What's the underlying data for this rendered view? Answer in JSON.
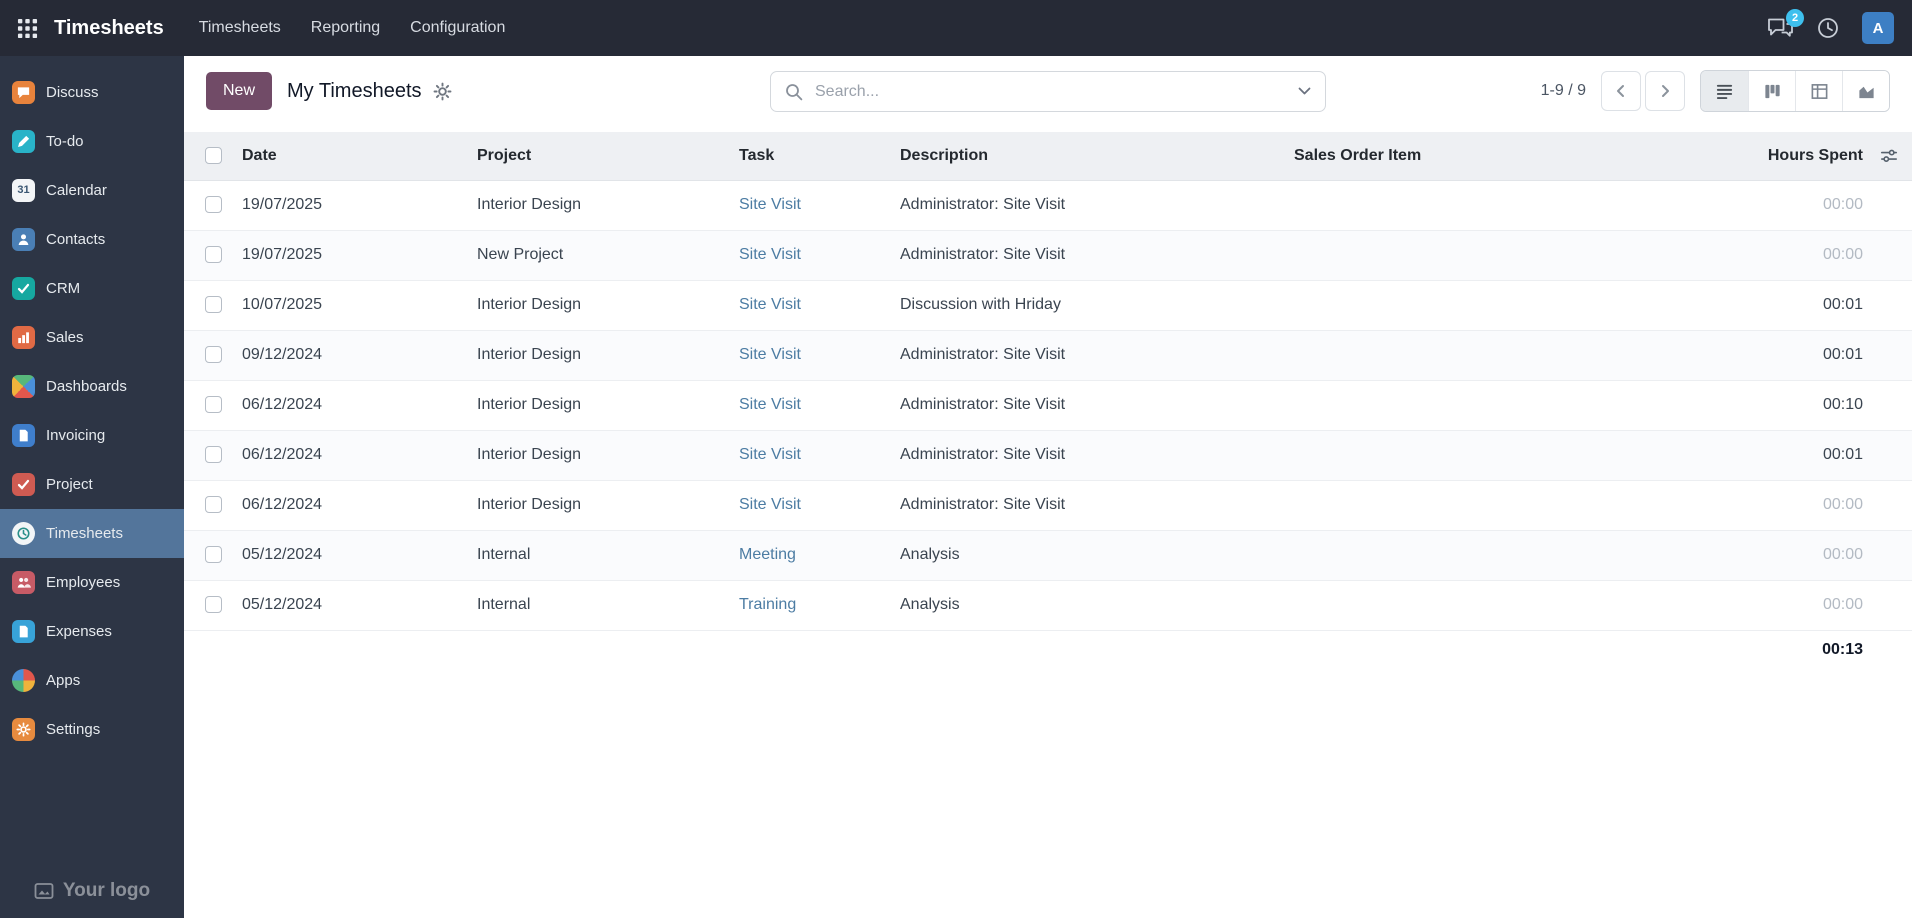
{
  "colors": {
    "topbar_bg": "#262a36",
    "sidebar_bg": "#2d3545",
    "sidebar_active_bg": "#53759b",
    "primary": "#714B67",
    "link": "#4c7ca3",
    "badge": "#3ec0ee",
    "avatar_bg": "#3d7fc4"
  },
  "topbar": {
    "brand": "Timesheets",
    "menu_items": [
      "Timesheets",
      "Reporting",
      "Configuration"
    ],
    "messages_badge": "2",
    "avatar_initial": "A"
  },
  "sidebar": {
    "active": "Timesheets",
    "logo_text": "Your logo",
    "items": [
      {
        "label": "Discuss",
        "icon": "discuss-icon",
        "color": "#e8833c",
        "glyph": "bubble"
      },
      {
        "label": "To-do",
        "icon": "todo-icon",
        "color": "#29b3c8",
        "glyph": "pencil"
      },
      {
        "label": "Calendar",
        "icon": "calendar-icon",
        "color": "#f3f5f7",
        "text_glyph": "31",
        "text_color": "#3b5773"
      },
      {
        "label": "Contacts",
        "icon": "contacts-icon",
        "color": "#4a7fb5",
        "glyph": "person"
      },
      {
        "label": "CRM",
        "icon": "crm-icon",
        "color": "#16a8a0",
        "glyph": "check"
      },
      {
        "label": "Sales",
        "icon": "sales-icon",
        "color": "#e06a45",
        "glyph": "bars"
      },
      {
        "label": "Dashboards",
        "icon": "dashboards-icon",
        "color": "conic-gradient(from 45deg, #4a90d9 0 25%, #e2574c 0 50%, #f0b33c 0 75%, #57b87b 0)",
        "glyph": ""
      },
      {
        "label": "Invoicing",
        "icon": "invoicing-icon",
        "color": "#3f7ecb",
        "glyph": "doc"
      },
      {
        "label": "Project",
        "icon": "project-icon",
        "color": "#cf5b52",
        "glyph": "check"
      },
      {
        "label": "Timesheets",
        "icon": "timesheets-icon",
        "color": "#f2f5f7",
        "shape": "circle",
        "glyph": "clock"
      },
      {
        "label": "Employees",
        "icon": "employees-icon",
        "color": "#c75b66",
        "glyph": "people"
      },
      {
        "label": "Expenses",
        "icon": "expenses-icon",
        "color": "#38a3d8",
        "glyph": "doc"
      },
      {
        "label": "Apps",
        "icon": "apps-icon",
        "color": "conic-gradient(#e2574c 0 25%, #f0b33c 0 50%, #57b87b 0 75%, #4a90d9 0)",
        "shape": "circle",
        "glyph": ""
      },
      {
        "label": "Settings",
        "icon": "settings-icon",
        "color": "#e78b3f",
        "glyph": "gear"
      }
    ]
  },
  "control_panel": {
    "new_button": "New",
    "breadcrumb": "My Timesheets",
    "search_placeholder": "Search...",
    "pager": "1-9 / 9"
  },
  "table": {
    "columns": [
      "Date",
      "Project",
      "Task",
      "Description",
      "Sales Order Item",
      "Hours Spent"
    ],
    "rows": [
      {
        "date": "19/07/2025",
        "project": "Interior Design",
        "task": "Site Visit",
        "description": "Administrator: Site Visit",
        "sales_order_item": "",
        "hours": "00:00",
        "muted": true
      },
      {
        "date": "19/07/2025",
        "project": "New Project",
        "task": "Site Visit",
        "description": "Administrator: Site Visit",
        "sales_order_item": "",
        "hours": "00:00",
        "muted": true
      },
      {
        "date": "10/07/2025",
        "project": "Interior Design",
        "task": "Site Visit",
        "description": "Discussion with Hriday",
        "sales_order_item": "",
        "hours": "00:01",
        "muted": false
      },
      {
        "date": "09/12/2024",
        "project": "Interior Design",
        "task": "Site Visit",
        "description": "Administrator: Site Visit",
        "sales_order_item": "",
        "hours": "00:01",
        "muted": false
      },
      {
        "date": "06/12/2024",
        "project": "Interior Design",
        "task": "Site Visit",
        "description": "Administrator: Site Visit",
        "sales_order_item": "",
        "hours": "00:10",
        "muted": false
      },
      {
        "date": "06/12/2024",
        "project": "Interior Design",
        "task": "Site Visit",
        "description": "Administrator: Site Visit",
        "sales_order_item": "",
        "hours": "00:01",
        "muted": false
      },
      {
        "date": "06/12/2024",
        "project": "Interior Design",
        "task": "Site Visit",
        "description": "Administrator: Site Visit",
        "sales_order_item": "",
        "hours": "00:00",
        "muted": true
      },
      {
        "date": "05/12/2024",
        "project": "Internal",
        "task": "Meeting",
        "description": "Analysis",
        "sales_order_item": "",
        "hours": "00:00",
        "muted": true
      },
      {
        "date": "05/12/2024",
        "project": "Internal",
        "task": "Training",
        "description": "Analysis",
        "sales_order_item": "",
        "hours": "00:00",
        "muted": true
      }
    ],
    "total_hours": "00:13"
  }
}
